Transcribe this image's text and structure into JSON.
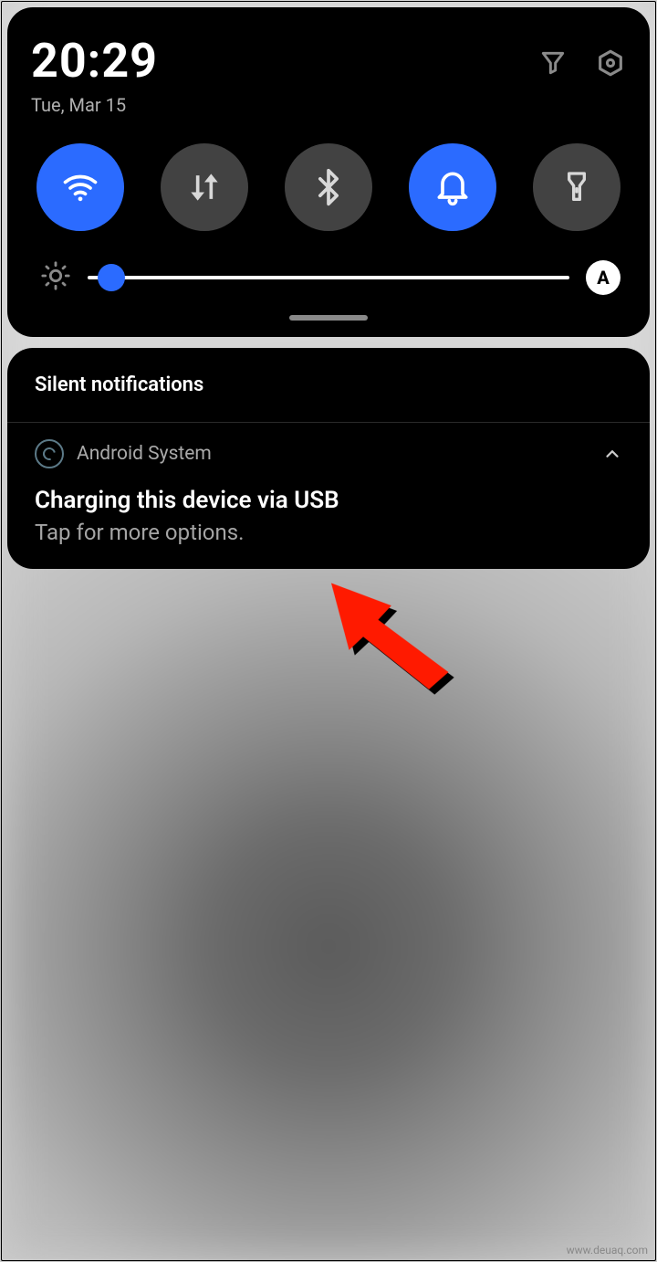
{
  "status": {
    "time": "20:29",
    "date": "Tue, Mar 15"
  },
  "toggles": {
    "wifi": {
      "state": "on",
      "name": "wifi"
    },
    "data": {
      "state": "off",
      "name": "mobile-data"
    },
    "bluetooth": {
      "state": "off",
      "name": "bluetooth"
    },
    "dnd": {
      "state": "on",
      "name": "do-not-disturb"
    },
    "flashlight": {
      "state": "off",
      "name": "flashlight"
    }
  },
  "brightness": {
    "value_percent": 5,
    "auto_label": "A"
  },
  "notifications": {
    "section_title": "Silent notifications",
    "items": [
      {
        "app": "Android System",
        "title": "Charging this device via USB",
        "text": "Tap for more options."
      }
    ]
  },
  "watermark": "www.deuaq.com"
}
